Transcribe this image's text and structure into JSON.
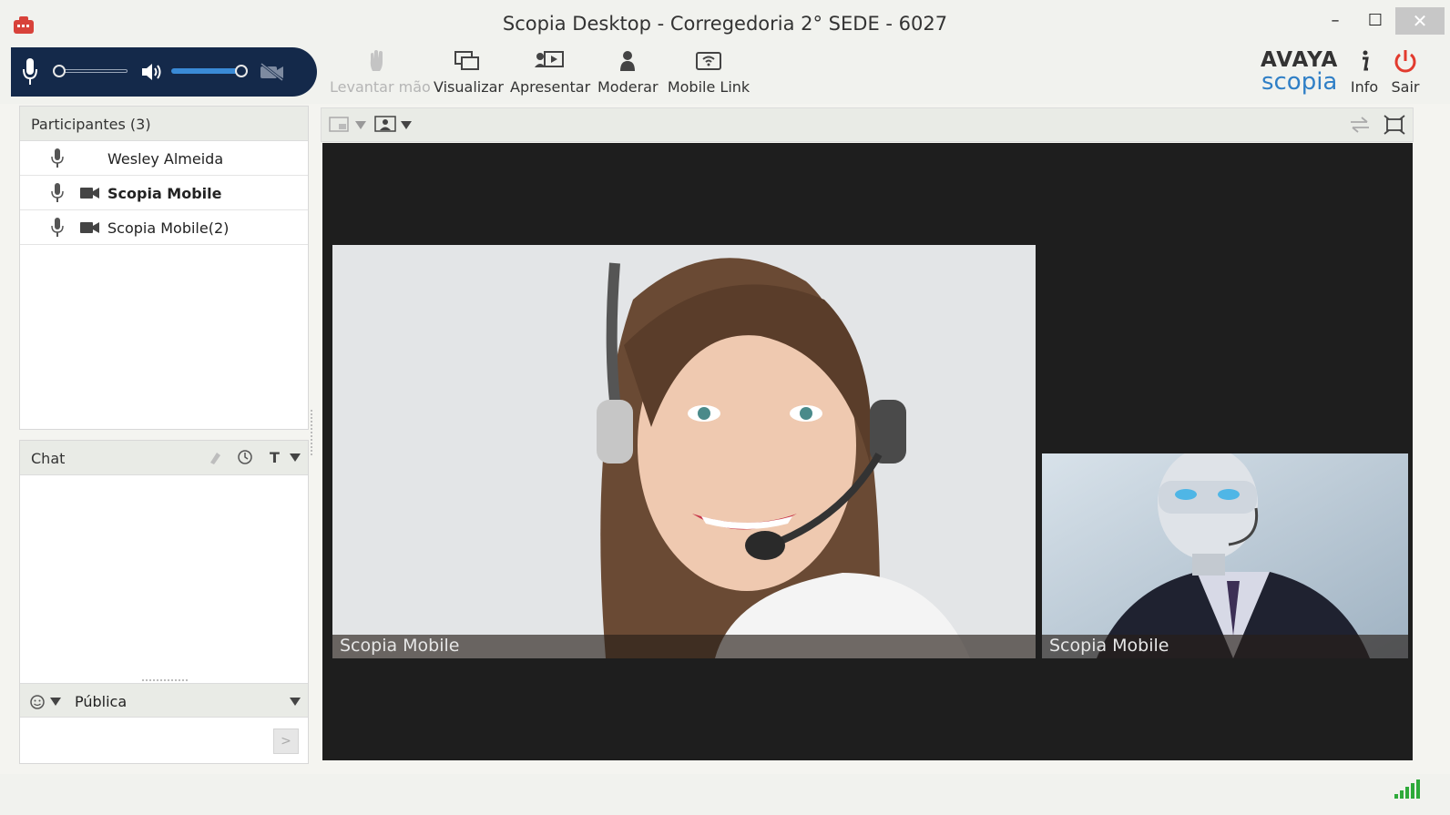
{
  "window": {
    "title": "Scopia Desktop - Corregedoria 2° SEDE - 6027",
    "min_symbol": "–",
    "max_symbol": "☐",
    "close_symbol": "✕"
  },
  "audio": {
    "mic_level": 0.0,
    "speaker_level": 1.0,
    "camera_state": "muted"
  },
  "toolbar": {
    "raise_hand_label": "Levantar mão",
    "view_label": "Visualizar",
    "present_label": "Apresentar",
    "moderate_label": "Moderar",
    "mobile_link_label": "Mobile Link",
    "info_label": "Info",
    "exit_label": "Sair",
    "brand_top": "AVAYA",
    "brand_bottom": "scopia"
  },
  "participants": {
    "header": "Participantes (3)",
    "items": [
      {
        "name": "Wesley Almeida",
        "video": false,
        "bold": false
      },
      {
        "name": "Scopia Mobile",
        "video": true,
        "bold": true
      },
      {
        "name": "Scopia Mobile(2)",
        "video": true,
        "bold": false
      }
    ]
  },
  "chat": {
    "header": "Chat",
    "text_format_symbol": "T",
    "recipient": "Pública",
    "send_symbol": ">"
  },
  "video": {
    "main_caption": "Scopia Mobile",
    "secondary_caption": "Scopia Mobile"
  },
  "colors": {
    "audio_panel": "#14294a",
    "accent_blue": "#2f7fc6",
    "exit_red": "#e23b2e",
    "signal_green": "#2eaa3a"
  }
}
